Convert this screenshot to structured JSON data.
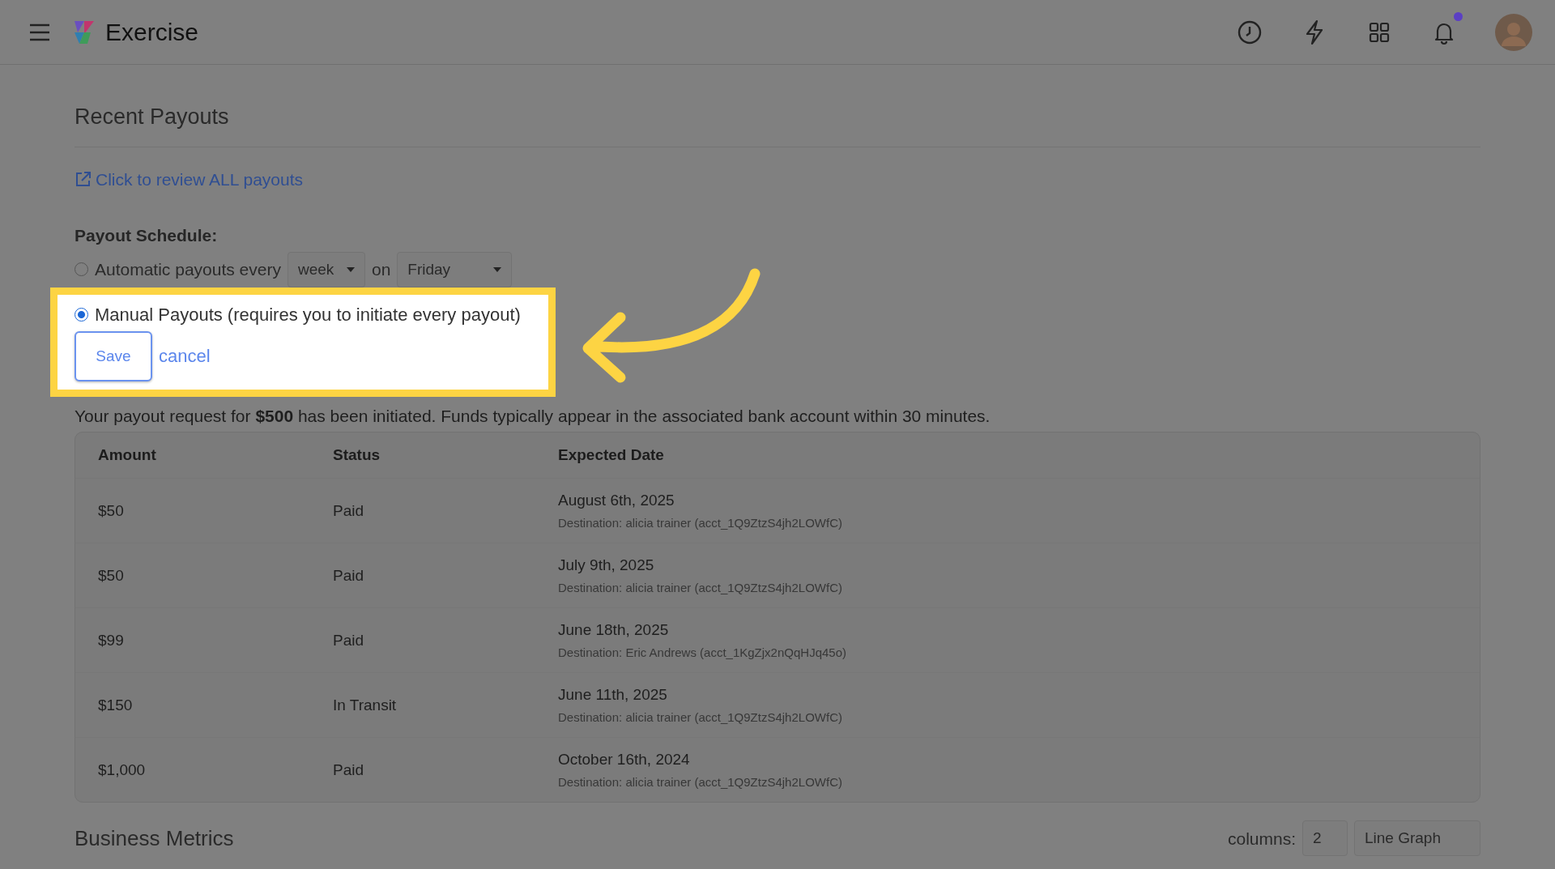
{
  "header": {
    "app_name": "Exercise",
    "notification_dot": true
  },
  "section_title": "Recent Payouts",
  "review_link": "Click to review ALL payouts",
  "schedule": {
    "label": "Payout Schedule:",
    "options": [
      {
        "kind": "automatic",
        "label": "Automatic payouts every",
        "selected": false,
        "period": "week",
        "joiner": "on",
        "day": "Friday"
      },
      {
        "kind": "manual",
        "label": "Manual Payouts (requires you to initiate every payout)",
        "selected": true
      }
    ],
    "save": "Save",
    "cancel": "cancel"
  },
  "message": "Your payout request for **$500** has been initiated. Funds typically appear in the associated bank account within 30 minutes.",
  "table": {
    "columns": [
      "Amount",
      "Status",
      "Expected Date"
    ],
    "rows": [
      {
        "amount": "$50",
        "status": "Paid",
        "date": "August 6th, 2025",
        "destination": "Destination: alicia trainer (acct_1Q9ZtzS4jh2LOWfC)"
      },
      {
        "amount": "$50",
        "status": "Paid",
        "date": "July 9th, 2025",
        "destination": "Destination: alicia trainer (acct_1Q9ZtzS4jh2LOWfC)"
      },
      {
        "amount": "$99",
        "status": "Paid",
        "date": "June 18th, 2025",
        "destination": "Destination: Eric Andrews (acct_1KgZjx2nQqHJq45o)"
      },
      {
        "amount": "$150",
        "status": "In Transit",
        "date": "June 11th, 2025",
        "destination": "Destination: alicia trainer (acct_1Q9ZtzS4jh2LOWfC)"
      },
      {
        "amount": "$1,000",
        "status": "Paid",
        "date": "October 16th, 2024",
        "destination": "Destination: alicia trainer (acct_1Q9ZtzS4jh2LOWfC)"
      }
    ]
  },
  "metrics": {
    "title": "Business Metrics",
    "columns_label": "columns:",
    "columns_value": "2",
    "chart_type": "Line Graph"
  }
}
